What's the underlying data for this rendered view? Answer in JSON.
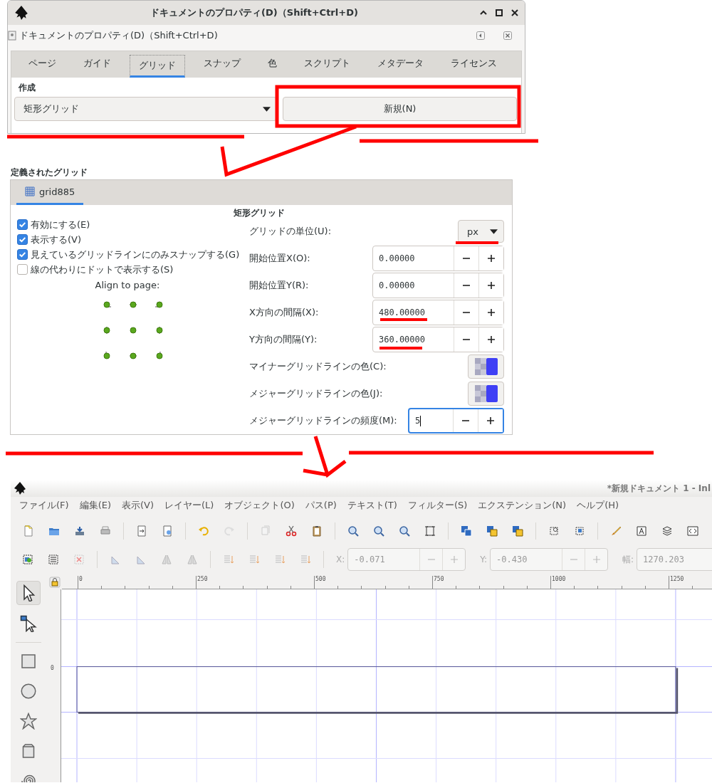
{
  "document_properties_dialog": {
    "title": "ドキュメントのプロパティ(D)（Shift+Ctrl+D)",
    "header": "ドキュメントのプロパティ(D)（Shift+Ctrl+D)",
    "tabs": [
      {
        "label": "ページ",
        "selected": false
      },
      {
        "label": "ガイド",
        "selected": false
      },
      {
        "label": "グリッド",
        "selected": true
      },
      {
        "label": "スナップ",
        "selected": false
      },
      {
        "label": "色",
        "selected": false
      },
      {
        "label": "スクリプト",
        "selected": false
      },
      {
        "label": "メタデータ",
        "selected": false
      },
      {
        "label": "ライセンス",
        "selected": false
      }
    ],
    "create_label": "作成",
    "grid_type_dropdown": {
      "value": "矩形グリッド"
    },
    "new_button": "新規(N)"
  },
  "defined_grids": {
    "heading": "定義されたグリッド",
    "grid_tabs": [
      {
        "label": "grid885",
        "selected": true
      }
    ],
    "section_title": "矩形グリッド",
    "checkboxes": [
      {
        "label": "有効にする(E)",
        "checked": true
      },
      {
        "label": "表示する(V)",
        "checked": true
      },
      {
        "label": "見えているグリッドラインにのみスナップする(G)",
        "checked": true
      },
      {
        "label": "線の代わりにドットで表示する(S)",
        "checked": false
      }
    ],
    "align_label": "Align to page:",
    "fields": [
      {
        "kind": "dropdown",
        "label": "グリッドの単位(U):",
        "value": "px"
      },
      {
        "kind": "spin",
        "label": "開始位置X(O):",
        "value": "0.00000",
        "focused": false
      },
      {
        "kind": "spin",
        "label": "開始位置Y(R):",
        "value": "0.00000",
        "focused": false
      },
      {
        "kind": "spin",
        "label": "X方向の間隔(X):",
        "value": "480.00000",
        "focused": false
      },
      {
        "kind": "spin",
        "label": "Y方向の間隔(Y):",
        "value": "360.00000",
        "focused": false
      },
      {
        "kind": "color",
        "label": "マイナーグリッドラインの色(C):"
      },
      {
        "kind": "color",
        "label": "メジャーグリッドラインの色(J):"
      },
      {
        "kind": "spin",
        "label": "メジャーグリッドラインの頻度(M):",
        "value": "5",
        "focused": true
      }
    ]
  },
  "inkscape_window": {
    "title": "*新規ドキュメント 1 - Inl",
    "menu": [
      "ファイル(F)",
      "編集(E)",
      "表示(V)",
      "レイヤー(L)",
      "オブジェクト(O)",
      "パス(P)",
      "テキスト(T)",
      "フィルター(S)",
      "エクステンション(N)",
      "ヘルプ(H)"
    ],
    "coordinate_fields": [
      {
        "label": "X:",
        "value": "-0.071",
        "disabled": true
      },
      {
        "label": "Y:",
        "value": "-0.430",
        "disabled": true
      },
      {
        "label": "幅:",
        "value": "1270.203",
        "disabled": true
      }
    ],
    "ruler_labels": [
      "0",
      "250",
      "500",
      "750",
      "1000",
      "1250"
    ],
    "vertical_ruler_label": "0"
  }
}
